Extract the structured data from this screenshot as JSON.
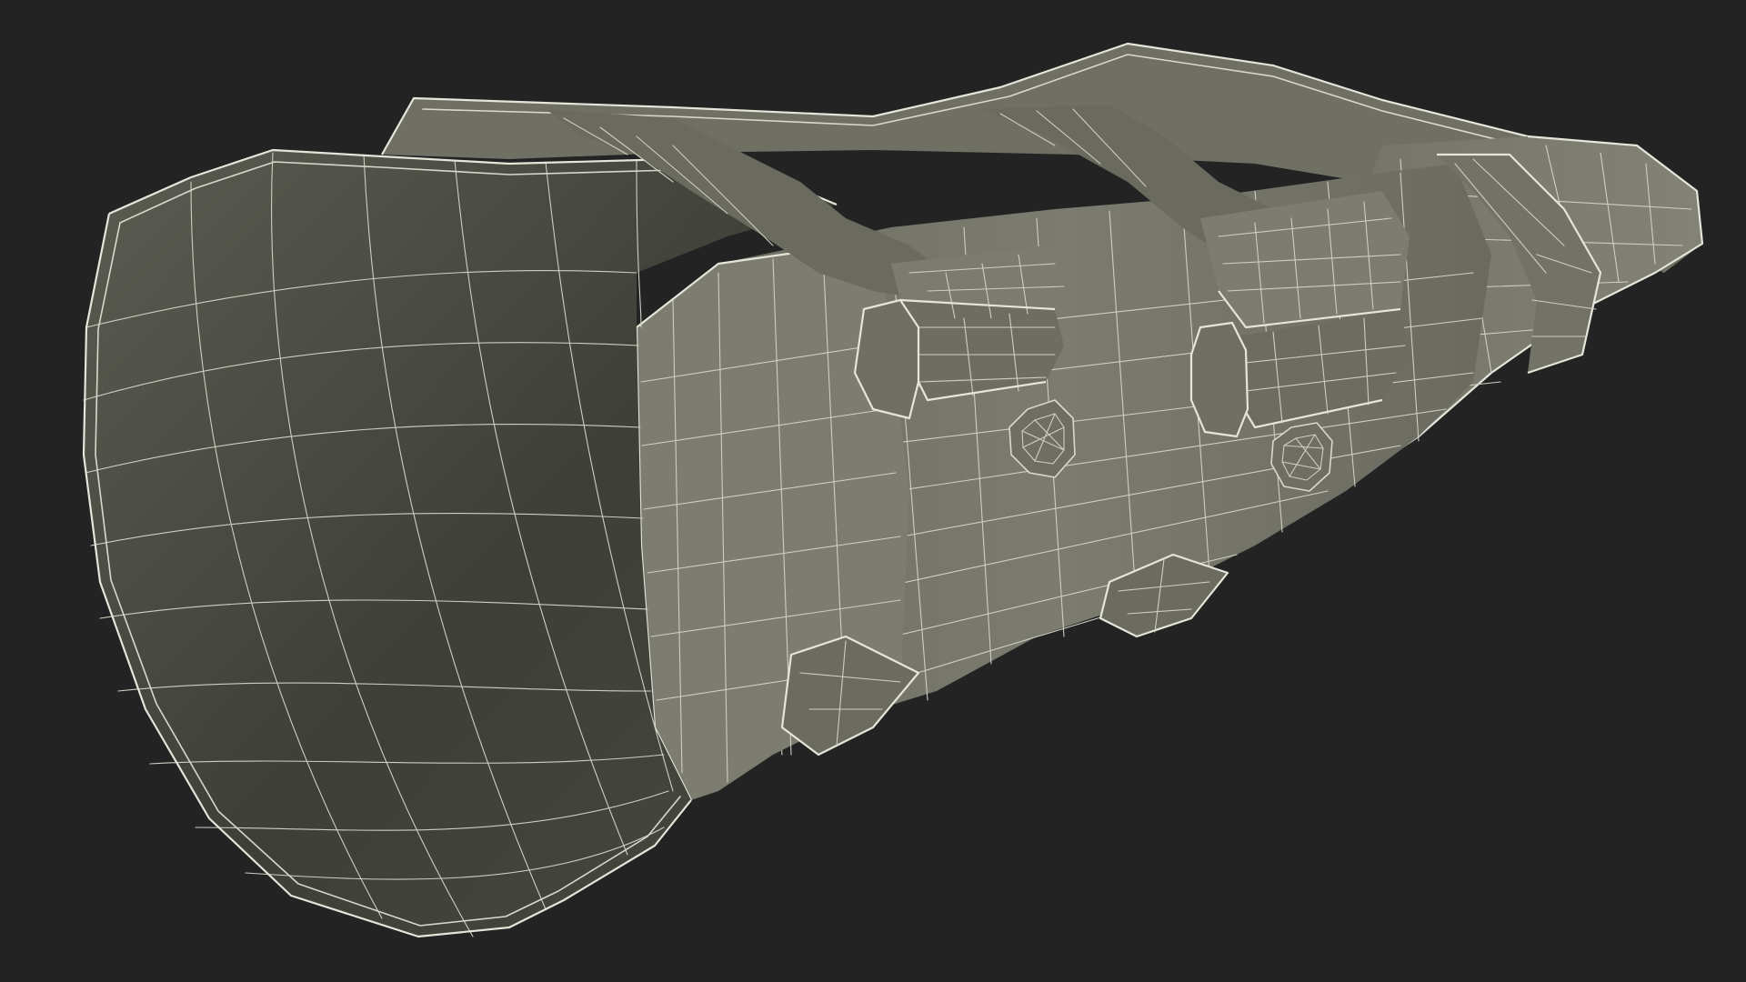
{
  "scene": {
    "subject_icon": "wrist-brace-wireframe-model-icon",
    "colors": {
      "background": "#232323",
      "inner_shell_dark": "#3d3e36",
      "inner_shell_light": "#5a5b51",
      "outer_shell": "#76766a",
      "outer_shell_light": "#85857a",
      "strap": "#6f6f64",
      "wireframe": "#d9d8cc"
    }
  }
}
